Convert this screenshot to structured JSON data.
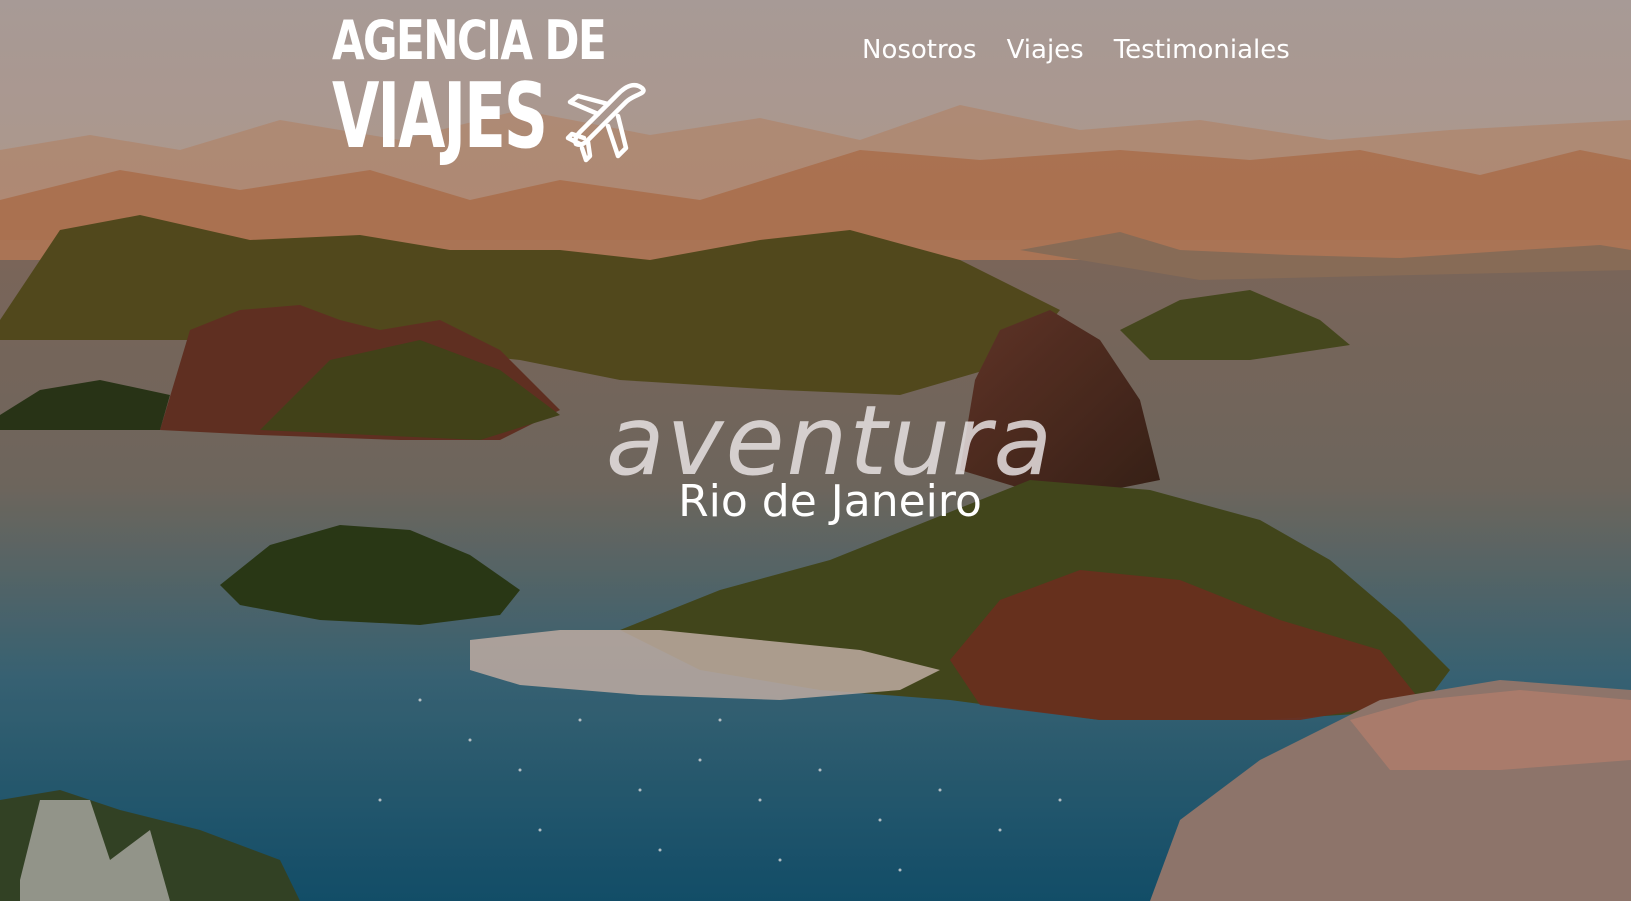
{
  "brand": {
    "line1": "AGENCIA DE",
    "line2": "VIAJES",
    "icon": "airplane-icon"
  },
  "nav": {
    "items": [
      {
        "label": "Nosotros"
      },
      {
        "label": "Viajes"
      },
      {
        "label": "Testimoniales"
      }
    ]
  },
  "hero": {
    "title": "aventura",
    "subtitle": "Rio de Janeiro"
  },
  "colors": {
    "text": "#ffffff",
    "sky": "#c9b7ad",
    "water": "#1f5d7a",
    "mountain_green": "#4d5a22",
    "rock": "#7a3a24"
  }
}
